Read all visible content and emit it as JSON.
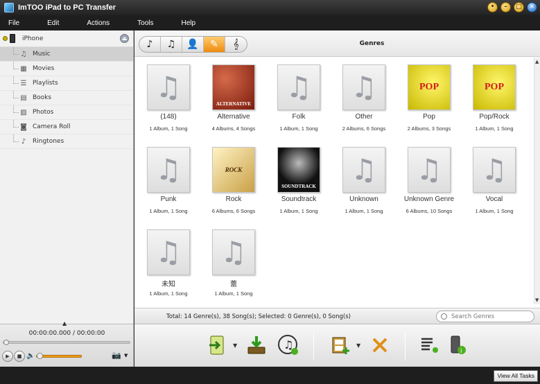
{
  "window": {
    "title": "ImTOO iPad to PC Transfer"
  },
  "menu": [
    "File",
    "Edit",
    "Actions",
    "Tools",
    "Help"
  ],
  "sidebar": {
    "device": "iPhone",
    "items": [
      {
        "label": "Music",
        "icon": "music-note-icon",
        "active": true
      },
      {
        "label": "Movies",
        "icon": "film-icon"
      },
      {
        "label": "Playlists",
        "icon": "playlist-icon"
      },
      {
        "label": "Books",
        "icon": "book-icon"
      },
      {
        "label": "Photos",
        "icon": "photo-icon"
      },
      {
        "label": "Camera Roll",
        "icon": "camera-icon"
      },
      {
        "label": "Ringtones",
        "icon": "ringtone-icon"
      }
    ]
  },
  "player": {
    "time": "00:00:00.000 / 00:00:00"
  },
  "content": {
    "tabs": [
      {
        "icon": "song-icon"
      },
      {
        "icon": "album-icon"
      },
      {
        "icon": "artist-icon"
      },
      {
        "icon": "genre-icon",
        "active": true
      },
      {
        "icon": "composer-icon"
      }
    ],
    "section_title": "Genres",
    "genres": [
      {
        "name": "(148)",
        "sub": "1 Album, 1 Song",
        "art": "note"
      },
      {
        "name": "Alternative",
        "sub": "4 Albums, 4 Songs",
        "art": "alt",
        "art_text": "ALTERNATIVE"
      },
      {
        "name": "Folk",
        "sub": "1 Album, 1 Song",
        "art": "note"
      },
      {
        "name": "Other",
        "sub": "2 Albums, 6 Songs",
        "art": "note"
      },
      {
        "name": "Pop",
        "sub": "2 Albums, 3 Songs",
        "art": "pop",
        "art_text": "POP"
      },
      {
        "name": "Pop/Rock",
        "sub": "1 Album, 1 Song",
        "art": "pop",
        "art_text": "POP"
      },
      {
        "name": "Punk",
        "sub": "1 Album, 1 Song",
        "art": "note"
      },
      {
        "name": "Rock",
        "sub": "6 Albums, 6 Songs",
        "art": "rock",
        "art_text": "ROCK"
      },
      {
        "name": "Soundtrack",
        "sub": "1 Album, 1 Song",
        "art": "sound",
        "art_text": "SOUNDTRACK"
      },
      {
        "name": "Unknown",
        "sub": "1 Album, 1 Song",
        "art": "note"
      },
      {
        "name": "Unknown Genre",
        "sub": "6 Albums, 10 Songs",
        "art": "note"
      },
      {
        "name": "Vocal",
        "sub": "1 Album, 1 Song",
        "art": "note"
      },
      {
        "name": "未知",
        "sub": "1 Album, 1 Song",
        "art": "note"
      },
      {
        "name": "蕾",
        "sub": "1 Album, 1 Song",
        "art": "note"
      }
    ],
    "status": "Total: 14 Genre(s), 38 Song(s); Selected: 0 Genre(s), 0 Song(s)",
    "search_placeholder": "Search Genres"
  },
  "actions": [
    {
      "name": "export-to-pc-button",
      "icon": "export-icon"
    },
    {
      "name": "import-button",
      "icon": "import-icon"
    },
    {
      "name": "add-to-itunes-button",
      "icon": "itunes-icon"
    },
    {
      "name": "add-video-button",
      "icon": "add-video-icon"
    },
    {
      "name": "delete-button",
      "icon": "delete-icon"
    },
    {
      "name": "playlist-button",
      "icon": "playlist-icon"
    },
    {
      "name": "device-info-button",
      "icon": "info-icon"
    }
  ],
  "bottom": {
    "view_all_tasks": "View All Tasks"
  },
  "colors": {
    "accent": "#ee8b10",
    "titlebar": "#2a2a2a"
  }
}
